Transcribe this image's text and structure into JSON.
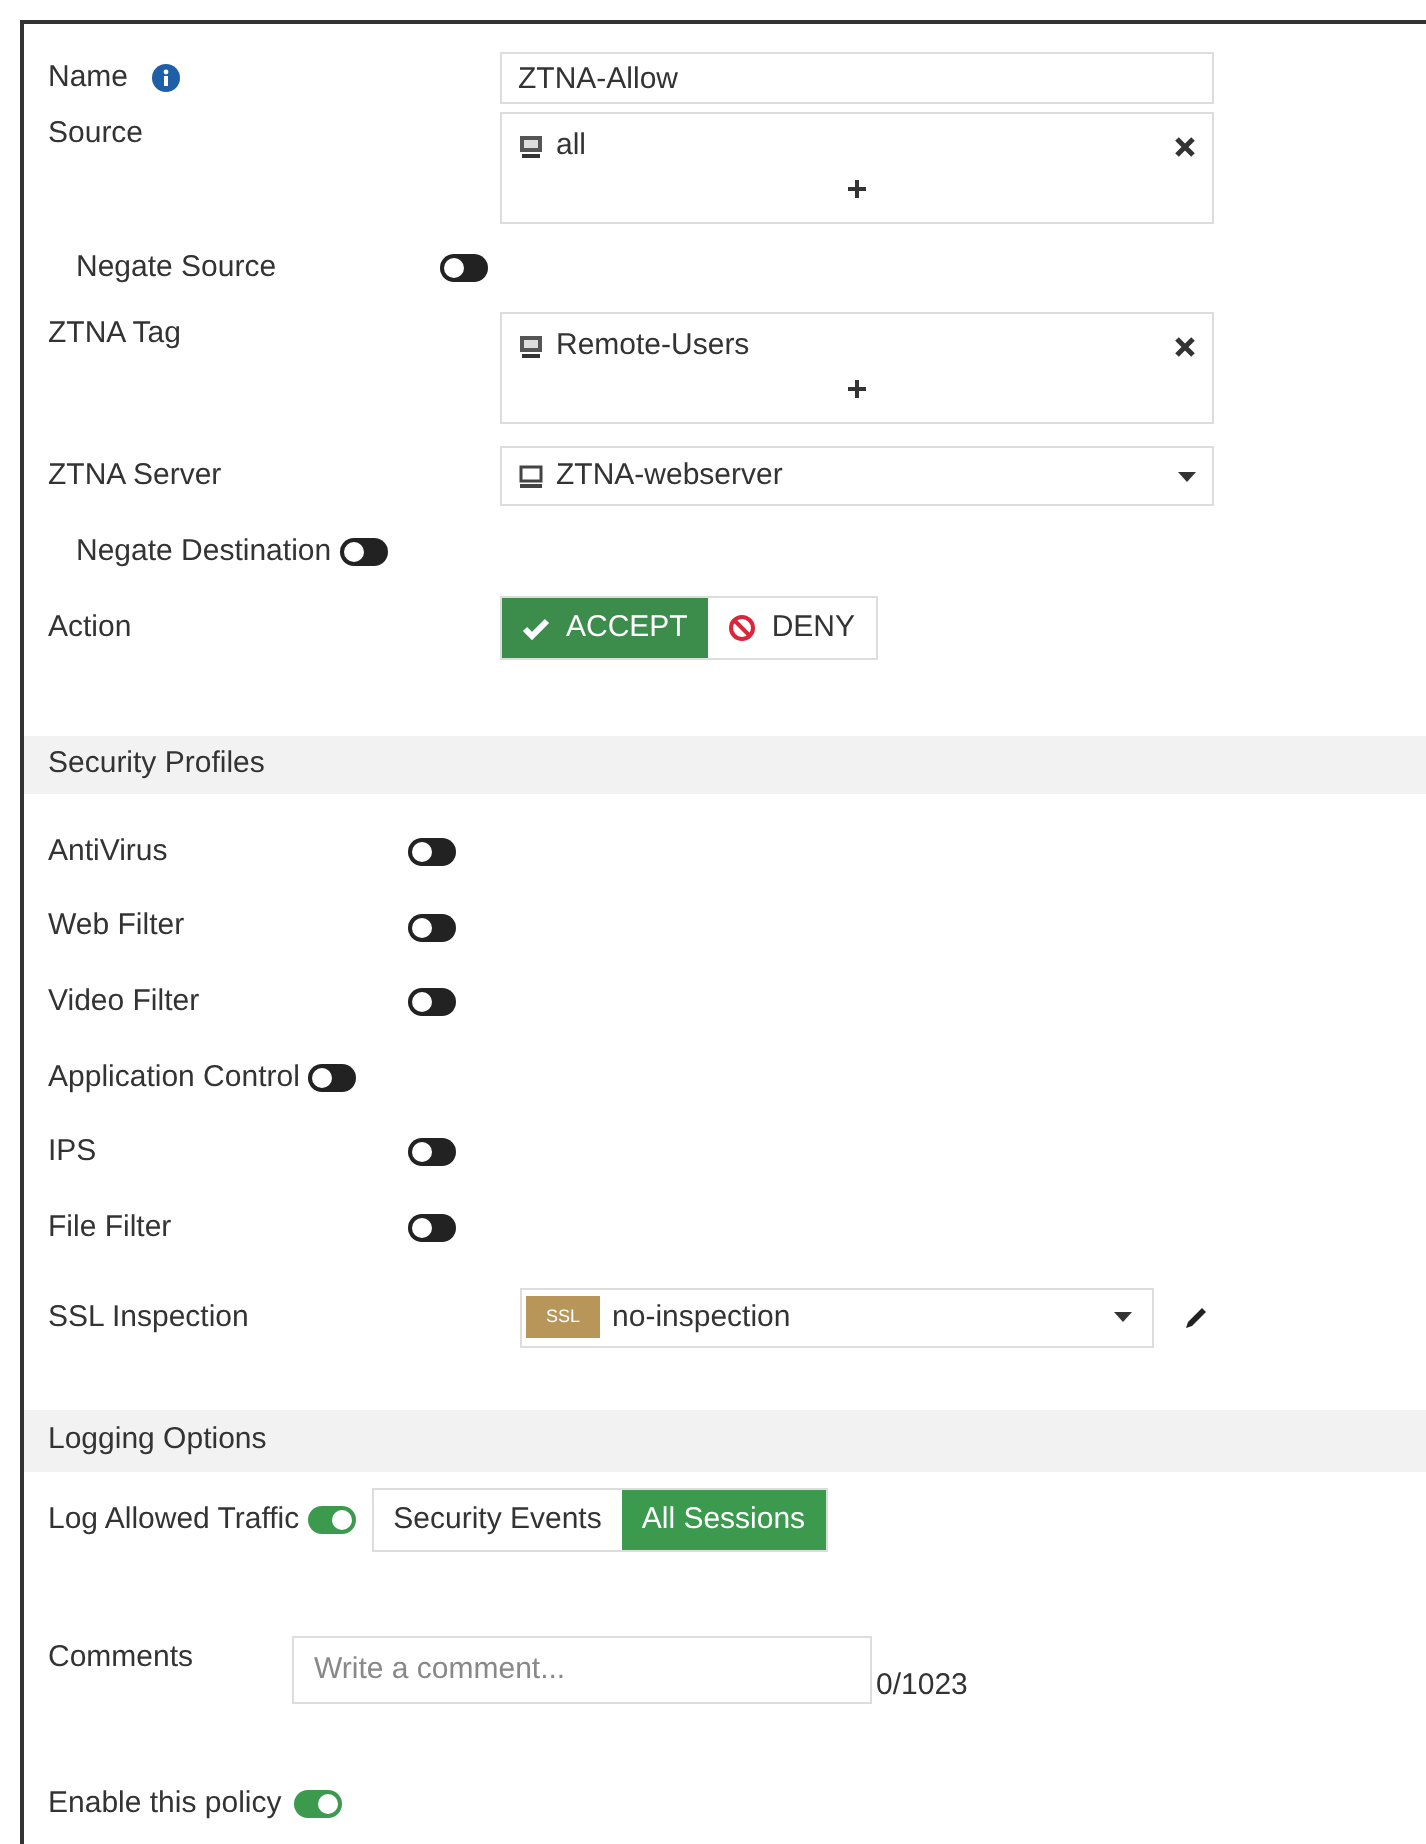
{
  "name": {
    "label": "Name",
    "value": "ZTNA-Allow"
  },
  "source": {
    "label": "Source",
    "items": [
      "all"
    ]
  },
  "negate_source": {
    "label": "Negate Source",
    "on": false
  },
  "ztna_tag": {
    "label": "ZTNA Tag",
    "items": [
      "Remote-Users"
    ]
  },
  "ztna_server": {
    "label": "ZTNA Server",
    "value": "ZTNA-webserver"
  },
  "negate_destination": {
    "label": "Negate Destination",
    "on": false
  },
  "action": {
    "label": "Action",
    "options": [
      {
        "label": "ACCEPT",
        "kind": "accept",
        "selected": true
      },
      {
        "label": "DENY",
        "kind": "deny",
        "selected": false
      }
    ]
  },
  "security_profiles": {
    "title": "Security Profiles",
    "toggles": [
      {
        "label": "AntiVirus",
        "on": false
      },
      {
        "label": "Web Filter",
        "on": false
      },
      {
        "label": "Video Filter",
        "on": false
      },
      {
        "label": "Application Control",
        "on": false
      },
      {
        "label": "IPS",
        "on": false
      },
      {
        "label": "File Filter",
        "on": false
      }
    ],
    "ssl_inspection": {
      "label": "SSL Inspection",
      "badge": "SSL",
      "value": "no-inspection"
    }
  },
  "logging_options": {
    "title": "Logging Options",
    "log_allowed_traffic": {
      "label": "Log Allowed Traffic",
      "on": true,
      "options": [
        {
          "label": "Security Events",
          "selected": false
        },
        {
          "label": "All Sessions",
          "selected": true
        }
      ]
    },
    "comments": {
      "label": "Comments",
      "placeholder": "Write a comment...",
      "counter": "0/1023"
    },
    "enable_policy": {
      "label": "Enable this policy",
      "on": true
    }
  }
}
